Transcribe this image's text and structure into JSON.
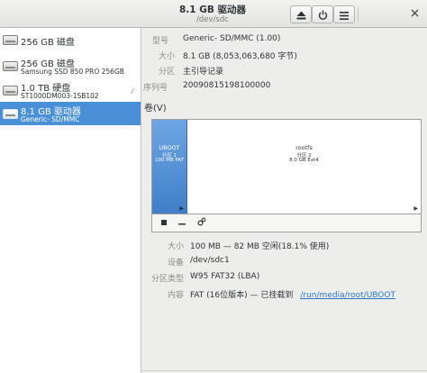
{
  "header": {
    "title": "8.1 GB 驱动器",
    "subtitle": "/dev/sdc"
  },
  "sidebar": {
    "drives": [
      {
        "name": "256 GB 磁盘",
        "model": "",
        "selected": false
      },
      {
        "name": "256 GB 磁盘",
        "model": "Samsung SSD 850 PRO 256GB",
        "selected": false
      },
      {
        "name": "1.0 TB 硬盘",
        "model": "ST1000DM003-1SB102",
        "selected": false
      },
      {
        "name": "8.1 GB 驱动器",
        "model": "Generic- SD/MMC",
        "selected": true
      }
    ]
  },
  "drive_info": {
    "model_label": "型号",
    "model_value": "Generic- SD/MMC (1.00)",
    "size_label": "大小",
    "size_value": "8.1 GB (8,053,063,680 字节)",
    "partition_label": "分区",
    "partition_value": "主引导记录",
    "serial_label": "序列号",
    "serial_value": "20090815198100000"
  },
  "volumes": {
    "title": "卷(V)",
    "segments": [
      {
        "name": "UBOOT",
        "partition": "分区 1",
        "detail": "100 MB FAT"
      },
      {
        "name": "rootfs",
        "partition": "分区 2",
        "detail": "8.0 GB Ext4"
      }
    ]
  },
  "volume_info": {
    "size_label": "大小",
    "size_value": "100 MB — 82 MB 空闲(18.1% 使用)",
    "device_label": "设备",
    "device_value": "/dev/sdc1",
    "ptype_label": "分区类型",
    "ptype_value": "W95 FAT32 (LBA)",
    "content_label": "内容",
    "content_value": "FAT (16位版本) — 已挂载到",
    "content_link": "/run/media/root/UBOOT"
  },
  "icons": {
    "eject": "eject-icon",
    "power": "power-icon",
    "menu": "menu-icon",
    "close": "close-icon",
    "stop": "stop-icon",
    "remove": "minus-icon",
    "settings": "gears-icon"
  },
  "colors": {
    "selection": "#4a90d9",
    "link": "#2a76c6"
  }
}
